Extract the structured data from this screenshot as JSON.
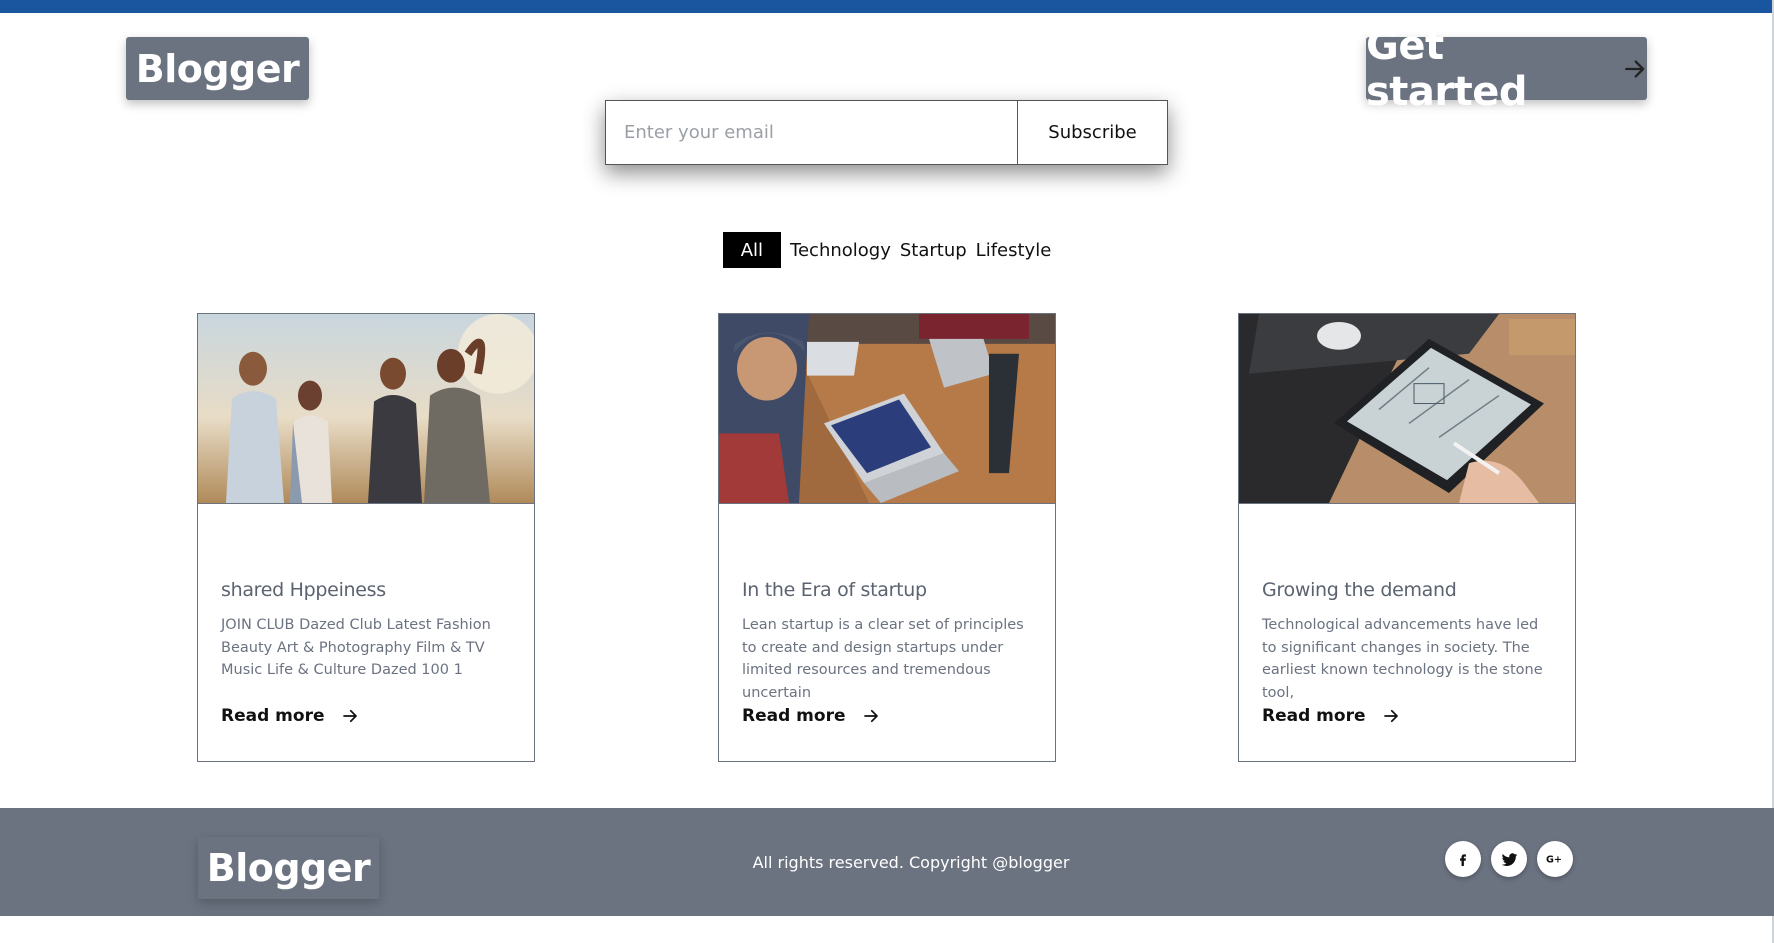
{
  "header": {
    "logo": "Blogger",
    "cta_label": "Get started"
  },
  "subscribe": {
    "placeholder": "Enter your email",
    "button_label": "Subscribe"
  },
  "filters": [
    "All",
    "Technology",
    "Startup",
    "Lifestyle"
  ],
  "filters_active": "All",
  "cards": [
    {
      "title": "shared Hppeiness",
      "excerpt": "JOIN CLUB Dazed Club Latest Fashion Beauty Art & Photography Film & TV Music Life & Culture Dazed 100 1",
      "link": "Read more",
      "image_subject": "group of friends outdoors"
    },
    {
      "title": "In the Era of startup",
      "excerpt": "Lean startup is a clear set of principles to create and design startups under limited resources and tremendous uncertain",
      "link": "Read more",
      "image_subject": "team meeting with laptops"
    },
    {
      "title": "Growing the demand",
      "excerpt": "Technological advancements have led to significant changes in society. The earliest known technology is the stone tool,",
      "link": "Read more",
      "image_subject": "tablet sketch on desk"
    }
  ],
  "footer": {
    "logo": "Blogger",
    "copyright": "All rights reserved. Copyright @blogger",
    "socials": [
      {
        "name": "facebook-icon",
        "glyph": "f"
      },
      {
        "name": "twitter-icon",
        "glyph": "🐦"
      },
      {
        "name": "google-plus-icon",
        "glyph": "G+"
      }
    ]
  },
  "colors": {
    "topbar": "#1a56a0",
    "gray": "#6b7280",
    "active_filter_bg": "#000000"
  }
}
